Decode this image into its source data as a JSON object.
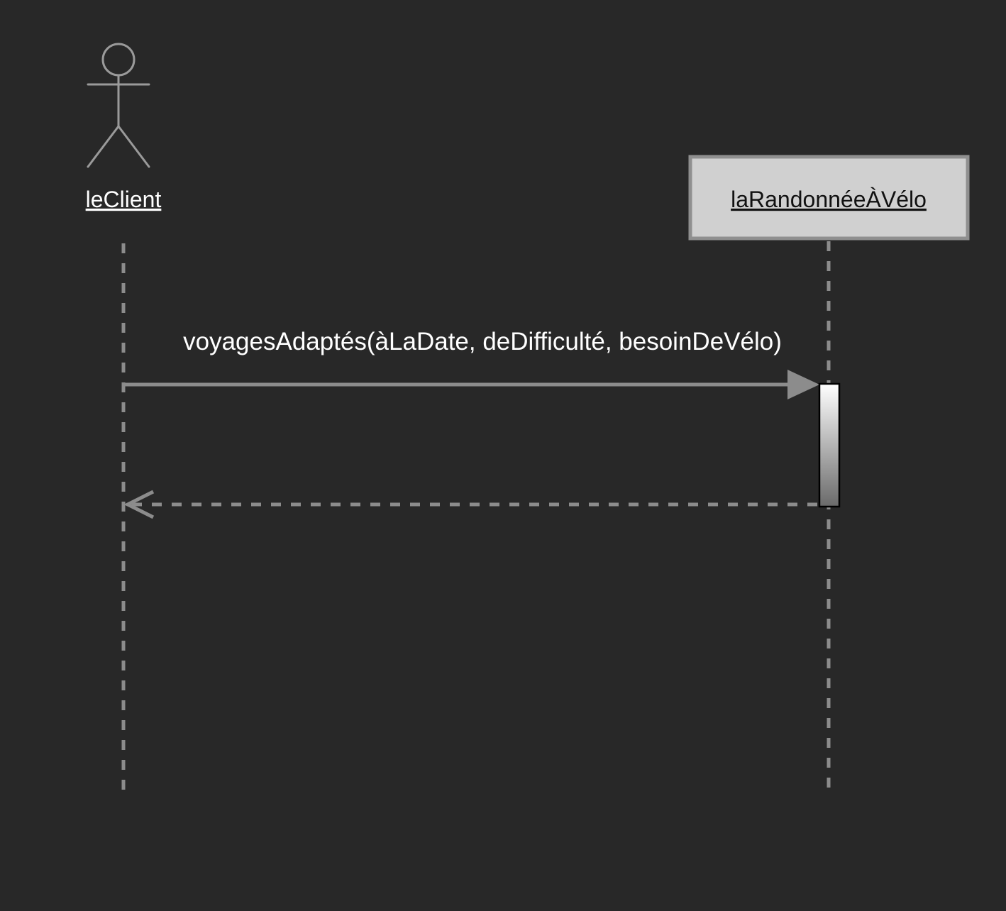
{
  "diagram": {
    "type": "sequence",
    "participants": [
      {
        "id": "client",
        "kind": "actor",
        "label": "leClient"
      },
      {
        "id": "rando",
        "kind": "object",
        "label": "laRandonnéeÀVélo"
      }
    ],
    "messages": [
      {
        "from": "client",
        "to": "rando",
        "kind": "synchronous-call",
        "label": "voyagesAdaptés(àLaDate, deDifficulté, besoinDeVélo)"
      },
      {
        "from": "rando",
        "to": "client",
        "kind": "return",
        "label": ""
      }
    ]
  },
  "colors": {
    "background": "#282828",
    "line": "#8c8c8c",
    "actor_stroke": "#9a9a9a",
    "object_fill": "#d0d0d0",
    "object_border": "#8f8f8f",
    "text_light": "#ffffff",
    "text_dark": "#111111"
  }
}
